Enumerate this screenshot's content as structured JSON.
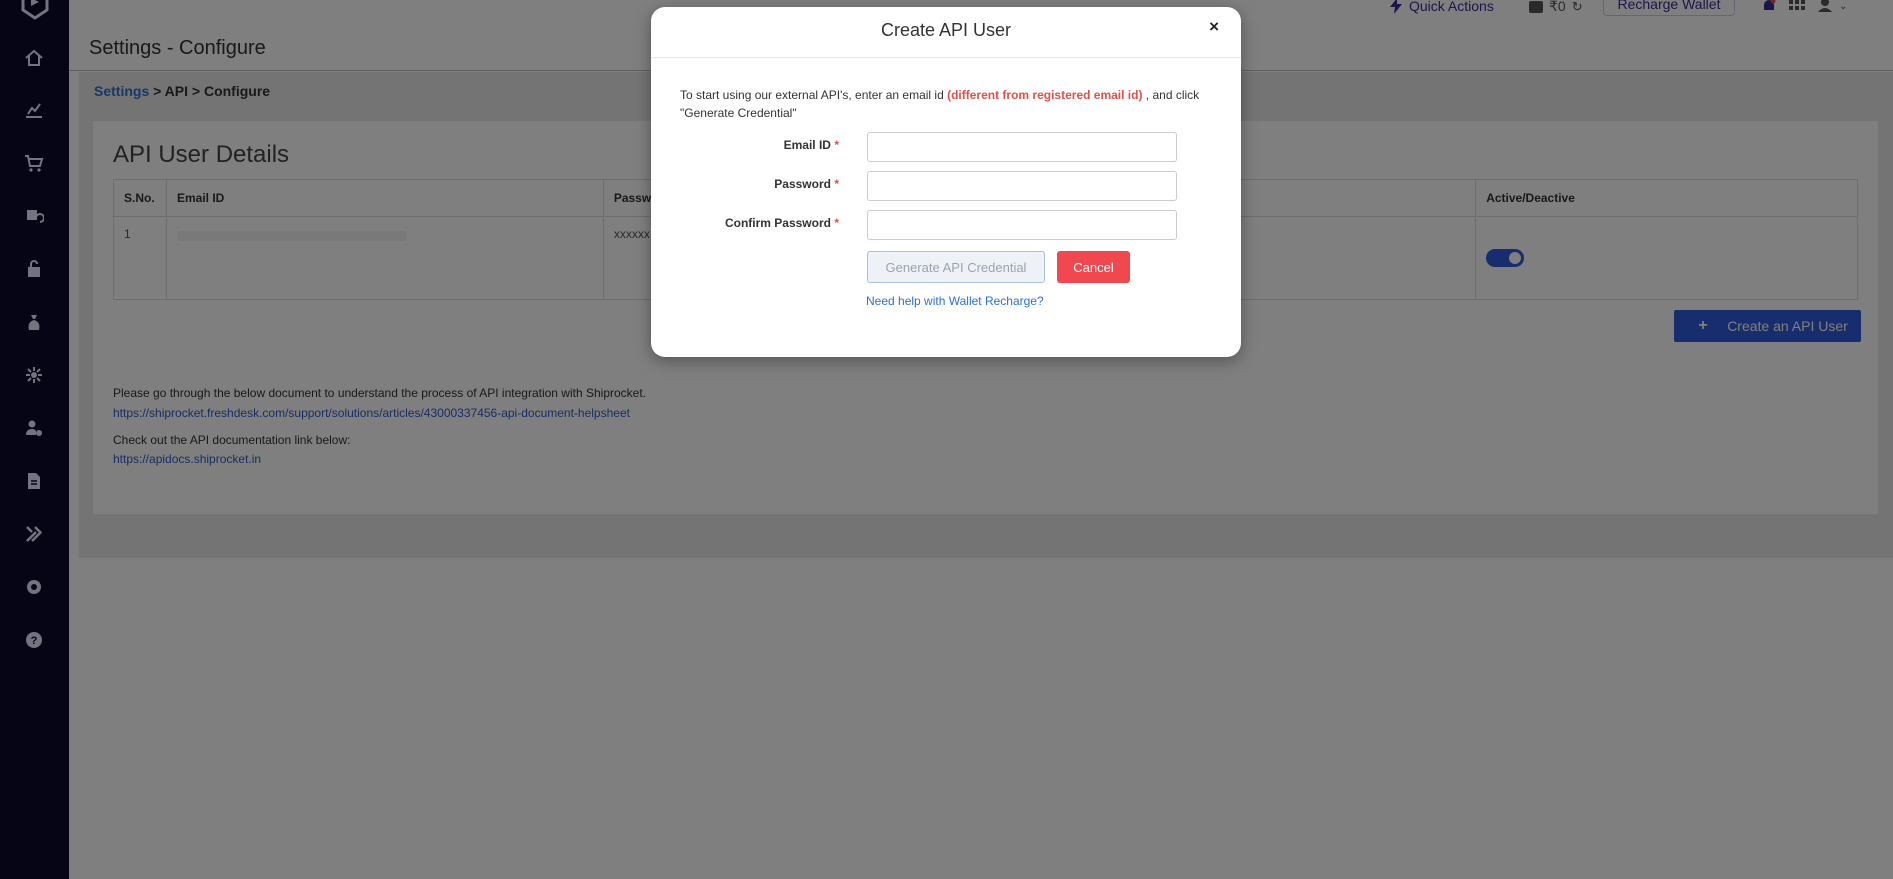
{
  "colors": {
    "sidebar_bg": "#0c0a2a",
    "accent_blue": "#2e5bdc",
    "danger": "#f0484f",
    "warning_text": "#e2504a"
  },
  "topbar": {
    "quick_actions": "Quick Actions",
    "wallet_balance": "₹0",
    "recharge_wallet": "Recharge Wallet"
  },
  "sidebar": {
    "items": [
      {
        "icon": "home-icon"
      },
      {
        "icon": "analytics-icon"
      },
      {
        "icon": "cart-icon"
      },
      {
        "icon": "returns-icon"
      },
      {
        "icon": "shipments-icon"
      },
      {
        "icon": "billing-icon"
      },
      {
        "icon": "channels-icon"
      },
      {
        "icon": "customers-icon"
      },
      {
        "icon": "reports-icon"
      },
      {
        "icon": "tools-icon"
      },
      {
        "icon": "settings-icon"
      },
      {
        "icon": "help-icon"
      }
    ]
  },
  "page": {
    "title": "Settings - Configure",
    "breadcrumb": {
      "settings": "Settings",
      "rest": " > API > Configure"
    },
    "card_title": "API User Details",
    "table": {
      "headers": [
        "S.No.",
        "Email ID",
        "Passwo",
        "Active/Deactive"
      ],
      "rows": [
        {
          "sno": "1",
          "password": "xxxxxx"
        }
      ]
    },
    "create_button": {
      "icon": "plus-icon",
      "label": "Create an API User"
    },
    "doc_text_1": "Please go through the below document to understand the process of API integration with Shiprocket.",
    "doc_link_1": "https://shiprocket.freshdesk.com/support/solutions/articles/43000337456-api-document-helpsheet",
    "doc_text_2": "Check out the API documentation link below:",
    "doc_link_2": "https://apidocs.shiprocket.in"
  },
  "modal": {
    "title": "Create API User",
    "close": "×",
    "intro_part1": "To start using our external API's, enter an email id ",
    "intro_warn": "(different from registered email id)",
    "intro_part2": " , and click \"Generate Credential\"",
    "required_mark": "*",
    "fields": {
      "email_label": "Email ID",
      "password_label": "Password",
      "confirm_label": "Confirm Password",
      "email_value": "",
      "password_value": "",
      "confirm_value": ""
    },
    "generate_button": "Generate API Credential",
    "cancel_button": "Cancel",
    "help_link": "Need help with Wallet Recharge?"
  }
}
